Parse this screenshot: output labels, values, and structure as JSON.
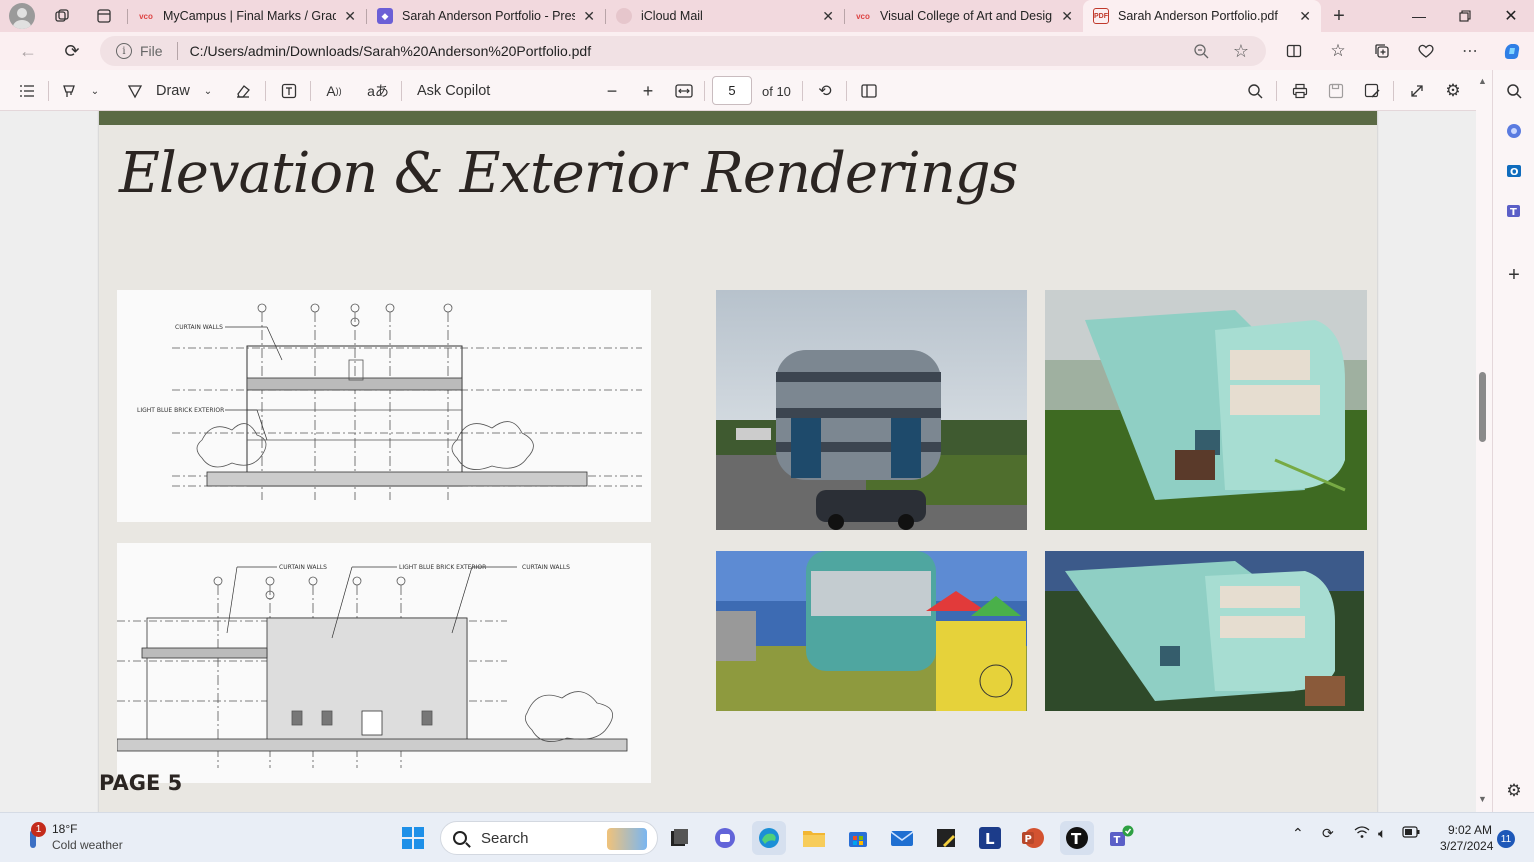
{
  "browser": {
    "tabs": [
      {
        "label": "MyCampus | Final Marks / Grade",
        "favicon": "vco-logo-icon",
        "active": false
      },
      {
        "label": "Sarah Anderson Portfolio - Prese",
        "favicon": "copilot-icon",
        "active": false
      },
      {
        "label": "iCloud Mail",
        "favicon": "icloud-icon",
        "active": false
      },
      {
        "label": "Visual College of Art and Design",
        "favicon": "vco-logo-icon",
        "active": false
      },
      {
        "label": "Sarah Anderson Portfolio.pdf",
        "favicon": "pdf-icon",
        "active": true
      }
    ],
    "address": {
      "scheme_label": "File",
      "url": "C:/Users/admin/Downloads/Sarah%20Anderson%20Portfolio.pdf"
    }
  },
  "pdf_toolbar": {
    "draw_label": "Draw",
    "ask_copilot_label": "Ask Copilot",
    "current_page": "5",
    "page_total_label": "of 10"
  },
  "document": {
    "page_title": "Elevation & Exterior Renderings",
    "page_label": "PAGE 5",
    "drawing_top_labels": [
      "CURTAIN WALLS",
      "LIGHT BLUE BRICK EXTERIOR"
    ],
    "drawing_bottom_labels": [
      "CURTAIN WALLS",
      "LIGHT BLUE BRICK EXTERIOR",
      "CURTAIN WALLS"
    ]
  },
  "taskbar": {
    "weather_temp": "18°F",
    "weather_desc": "Cold weather",
    "weather_badge": "1",
    "search_label": "Search",
    "time": "9:02 AM",
    "date": "3/27/2024",
    "notification_count": "11"
  },
  "colors": {
    "page_band": "#5b6a45",
    "page_bg": "#e9e7e2",
    "tabstrip": "#f2d9de",
    "accent_blue": "#1e58b8"
  }
}
